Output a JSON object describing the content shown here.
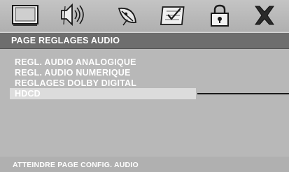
{
  "header": {
    "title": "PAGE REGLAGES AUDIO"
  },
  "icons": [
    "tv-screen-icon",
    "speaker-icon",
    "satellite-dish-icon",
    "checklist-icon",
    "lock-icon",
    "close-icon"
  ],
  "menu": {
    "items": [
      {
        "label": "REGL. AUDIO ANALOGIQUE"
      },
      {
        "label": "REGL. AUDIO NUMERIQUE"
      },
      {
        "label": "REGLAGES DOLBY DIGITAL"
      },
      {
        "label": "HDCD",
        "selected": true
      }
    ]
  },
  "footer": {
    "text": "ATTEINDRE PAGE CONFIG. AUDIO"
  },
  "colors": {
    "background": "#b8b8b8",
    "header": "#6e6e6e",
    "selection": "#dcdcdc",
    "text": "#ffffff"
  }
}
